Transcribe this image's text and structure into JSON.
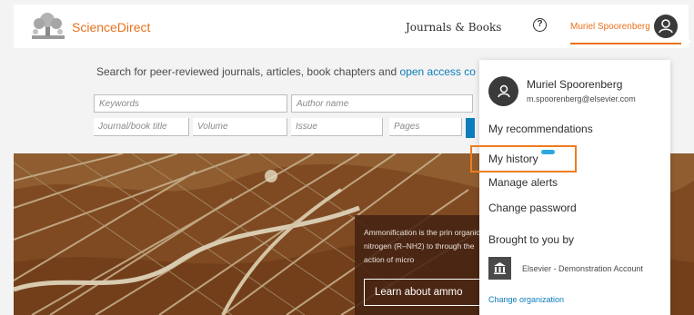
{
  "header": {
    "brand": "ScienceDirect",
    "nav_journals_books": "Journals & Books",
    "help_glyph": "?",
    "user_name": "Muriel Spoorenberg",
    "colors": {
      "brand": "#e9711c",
      "link": "#0c7dbb"
    }
  },
  "search": {
    "intro_prefix": "Search for peer-reviewed journals, articles, book chapters and ",
    "intro_link": "open access co",
    "keywords_placeholder": "Keywords",
    "author_placeholder": "Author name",
    "journal_placeholder": "Journal/book title",
    "volume_placeholder": "Volume",
    "issue_placeholder": "Issue",
    "pages_placeholder": "Pages"
  },
  "hero": {
    "caption": "Ammonification is the prin organic nitrogen (R–NH2) to through the action of micro",
    "button_label": "Learn about ammo"
  },
  "user_menu": {
    "name": "Muriel Spoorenberg",
    "email": "m.spoorenberg@elsevier.com",
    "items": [
      {
        "label": "My recommendations"
      },
      {
        "label": "My history"
      },
      {
        "label": "Manage alerts"
      },
      {
        "label": "Change password"
      }
    ],
    "brought_to_you_by": "Brought to you by",
    "institution": "Elsevier - Demonstration Account",
    "change_organization": "Change organization",
    "highlight_color": "#f07c1f"
  },
  "icons": [
    "elsevier-tree-logo-icon",
    "help-icon",
    "user-avatar-icon",
    "institution-building-icon",
    "new-badge-icon"
  ]
}
